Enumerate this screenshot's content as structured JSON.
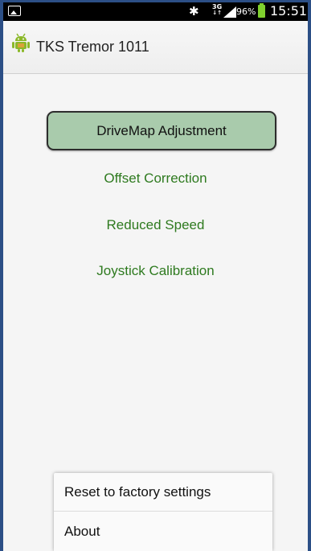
{
  "status_bar": {
    "gallery_icon": "picture-notification-icon",
    "bluetooth_icon": "bluetooth-icon",
    "network_type": "3G",
    "signal_icon": "signal-bars-icon",
    "battery_percent": "96%",
    "battery_icon": "battery-icon",
    "time": "15:51"
  },
  "action_bar": {
    "app_icon": "android-robot-icon",
    "title": "TKS Tremor 1011"
  },
  "main": {
    "primary_button": "DriveMap Adjustment",
    "links": [
      "Offset Correction",
      "Reduced Speed",
      "Joystick Calibration"
    ]
  },
  "overflow_menu": {
    "items": [
      "Reset to factory settings",
      "About"
    ]
  },
  "colors": {
    "button_fill": "#a9cbac",
    "link_text": "#2e7a1f",
    "battery": "#7fd02e",
    "background": "#f5f5f5"
  }
}
